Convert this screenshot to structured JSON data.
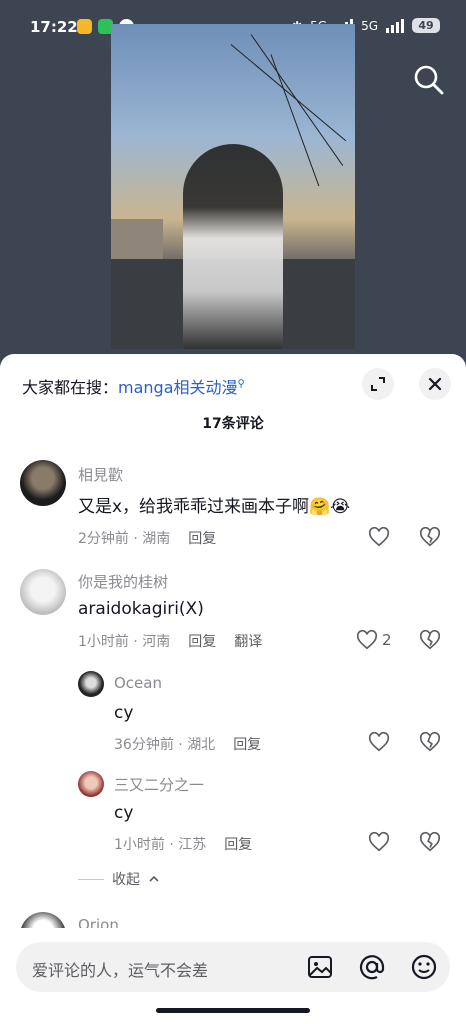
{
  "status": {
    "time": "17:22",
    "network1": "5G",
    "network2": "5G",
    "battery": "49"
  },
  "hot_search": {
    "prefix": "大家都在搜：",
    "keyword": "manga相关动漫"
  },
  "comments_title": "17条评论",
  "comments": [
    {
      "user": "相見歡",
      "text": "又是x，给我乖乖过来画本子啊🤗😭",
      "time": "2分钟前",
      "region": "湖南",
      "reply": "回复",
      "likes": ""
    },
    {
      "user": "你是我的桂树",
      "text": "araidokagiri(X)",
      "time": "1小时前",
      "region": "河南",
      "reply": "回复",
      "translate": "翻译",
      "likes": "2"
    }
  ],
  "replies": [
    {
      "user": "Ocean",
      "text": "cy",
      "time": "36分钟前",
      "region": "湖北",
      "reply": "回复"
    },
    {
      "user": "三又二分之一",
      "text": "cy",
      "time": "1小时前",
      "region": "江苏",
      "reply": "回复"
    }
  ],
  "collapse_label": "收起",
  "next_user": "Orion",
  "input_placeholder": "爱评论的人，运气不会差",
  "colors": {
    "link": "#2a61c7",
    "sheet": "#ffffff",
    "background": "#3d4552"
  }
}
